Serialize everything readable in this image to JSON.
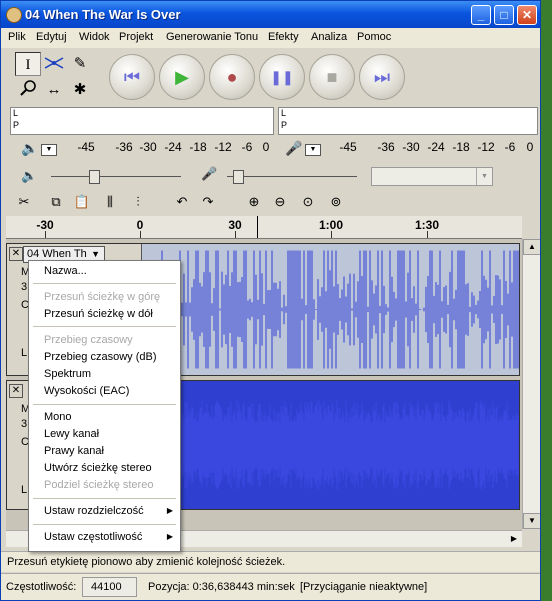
{
  "window": {
    "title": "04 When The War Is Over",
    "controls": {
      "minimize": "_",
      "maximize": "□",
      "close": "✕"
    }
  },
  "menubar": [
    "Plik",
    "Edytuj",
    "Widok",
    "Projekt",
    "Generowanie Tonu",
    "Efekty",
    "Analiza",
    "Pomoc"
  ],
  "tools": {
    "selection": "I",
    "envelope": "envelope-icon",
    "draw": "✎",
    "zoom": "zoom-icon",
    "timeshift": "↔",
    "multi": "✱"
  },
  "transport": {
    "skip_start": "⏮",
    "play": "▶",
    "record": "●",
    "pause": "❚❚",
    "stop": "■",
    "skip_end": "⏭",
    "colors": {
      "play": "#3fb53a",
      "record": "#b04a4a",
      "nav": "#6a6ad8"
    }
  },
  "meters": {
    "left_label": "L",
    "right_label": "P",
    "scale": [
      "-45",
      "-36",
      "-30",
      "-24",
      "-18",
      "-12",
      "-6",
      "0"
    ]
  },
  "ruler": [
    "-30",
    "0",
    "30",
    "1:00",
    "1:30"
  ],
  "tracks": [
    {
      "name": "04 When Th",
      "info_lines": [
        "M",
        "3",
        "C",
        "L"
      ],
      "wave_color": "#2f3fd6",
      "wave_bg": "#bcc6d8"
    },
    {
      "name": "",
      "info_lines": [
        "M",
        "3",
        "C",
        "L"
      ],
      "wave_color": "#3a48e0",
      "wave_bg": "#2f3fd0"
    }
  ],
  "context_menu": {
    "items": [
      {
        "label": "Nazwa...",
        "enabled": true
      },
      {
        "label": "Przesuń ścieżkę w górę",
        "enabled": false
      },
      {
        "label": "Przesuń ścieżkę w dół",
        "enabled": true
      },
      {
        "label": "Przebieg czasowy",
        "enabled": false
      },
      {
        "label": "Przebieg czasowy (dB)",
        "enabled": true
      },
      {
        "label": "Spektrum",
        "enabled": true
      },
      {
        "label": "Wysokości (EAC)",
        "enabled": true
      },
      {
        "label": "Mono",
        "enabled": true
      },
      {
        "label": "Lewy kanał",
        "enabled": true
      },
      {
        "label": "Prawy kanał",
        "enabled": true
      },
      {
        "label": "Utwórz ścieżkę stereo",
        "enabled": true
      },
      {
        "label": "Podziel ścieżkę stereo",
        "enabled": false
      },
      {
        "label": "Ustaw rozdzielczość",
        "enabled": true,
        "submenu": true
      },
      {
        "label": "Ustaw częstotliwość",
        "enabled": true,
        "submenu": true
      }
    ]
  },
  "status": "Przesuń etykietę pionowo aby zmienić kolejność ścieżek.",
  "bottom": {
    "rate_label": "Częstotliwość:",
    "rate_value": "44100",
    "position": "Pozycja: 0:36,638443 min:sek",
    "snap": "[Przyciąganie nieaktywne]"
  }
}
